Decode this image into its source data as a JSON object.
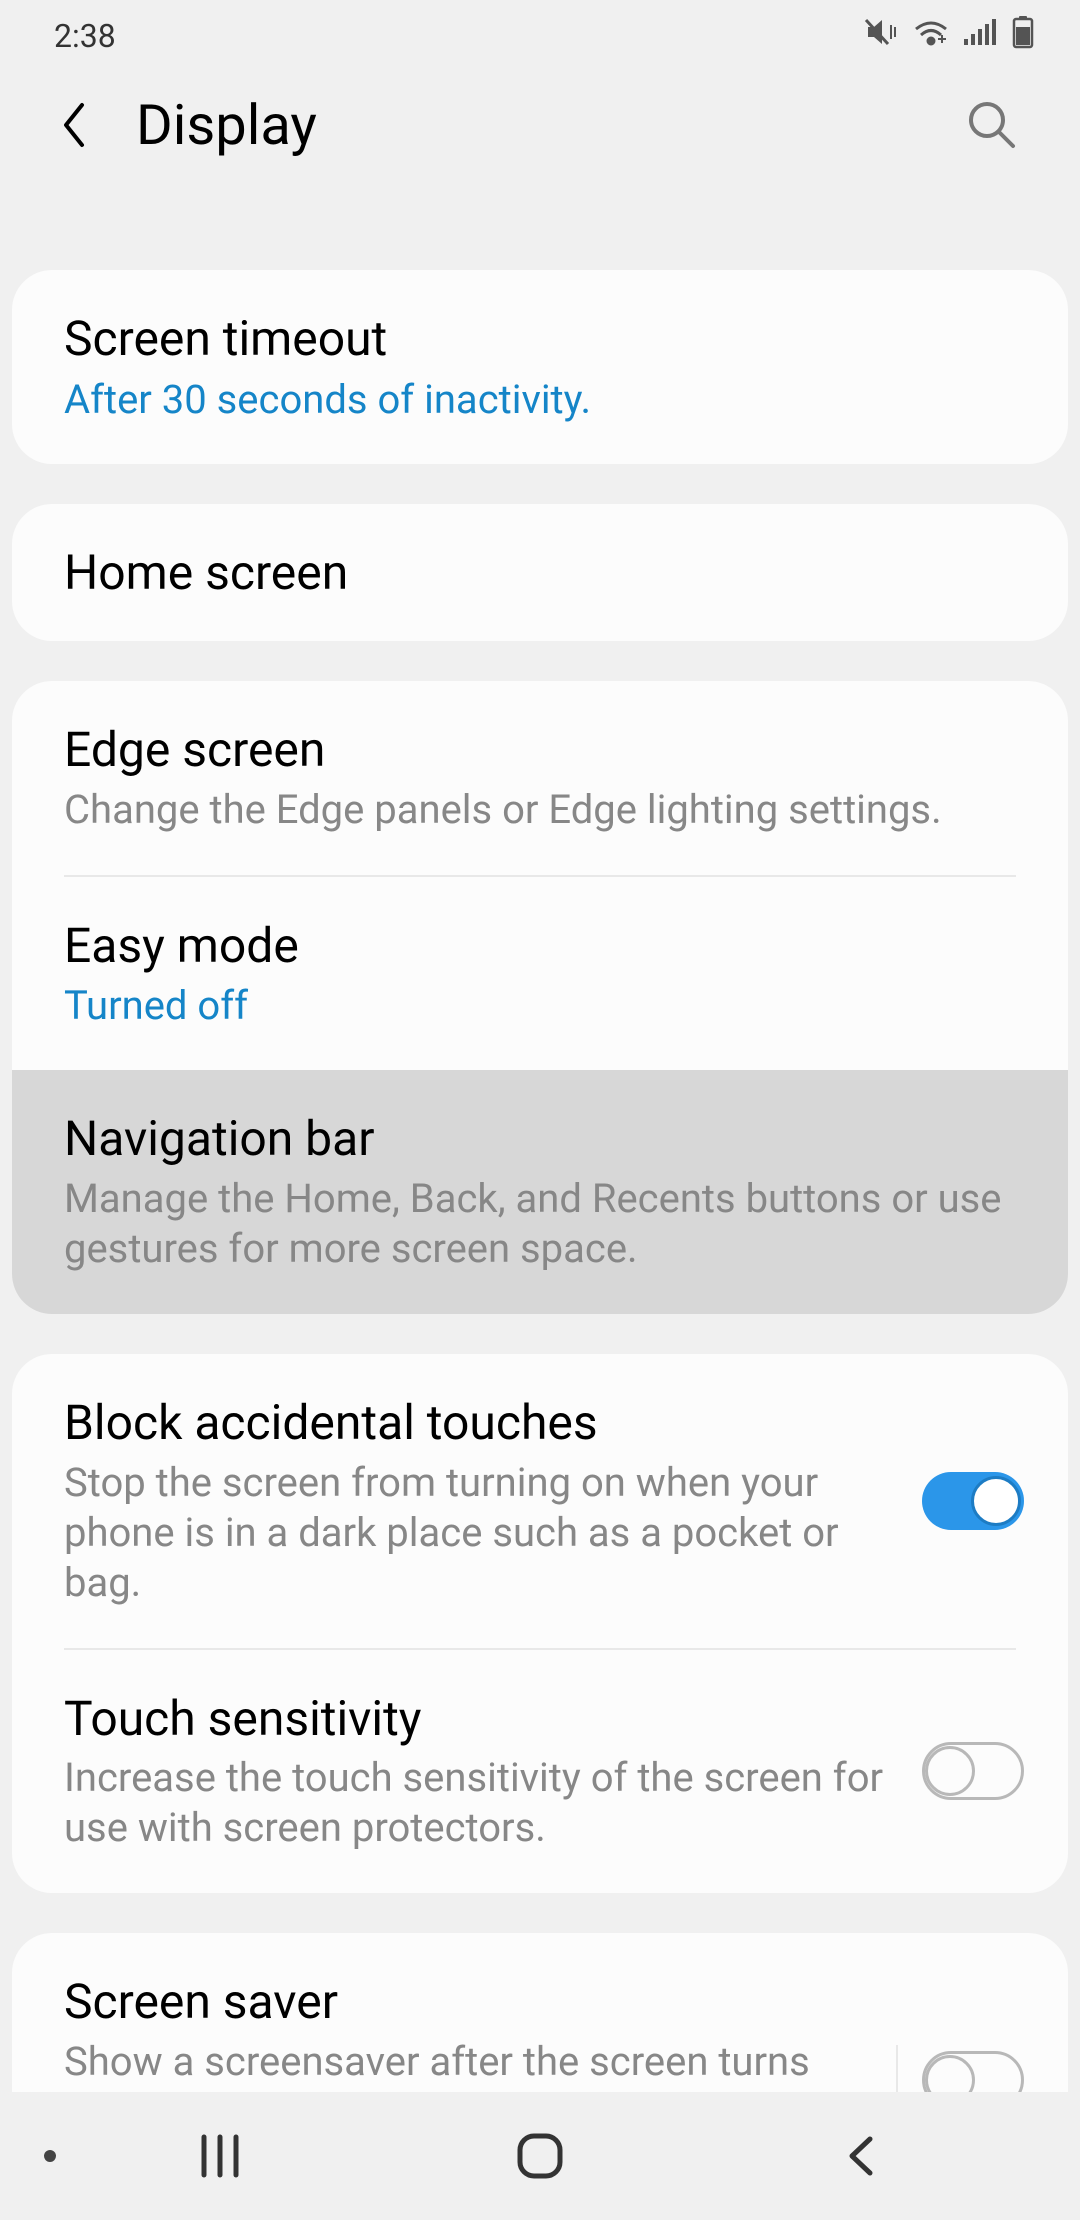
{
  "status": {
    "time": "2:38"
  },
  "header": {
    "title": "Display"
  },
  "settings": {
    "screen_timeout": {
      "title": "Screen timeout",
      "subtitle": "After 30 seconds of inactivity."
    },
    "home_screen": {
      "title": "Home screen"
    },
    "edge_screen": {
      "title": "Edge screen",
      "subtitle": "Change the Edge panels or Edge lighting settings."
    },
    "easy_mode": {
      "title": "Easy mode",
      "subtitle": "Turned off"
    },
    "navigation_bar": {
      "title": "Navigation bar",
      "subtitle": "Manage the Home, Back, and Recents buttons or use gestures for more screen space."
    },
    "block_touches": {
      "title": "Block accidental touches",
      "subtitle": "Stop the screen from turning on when your phone is in a dark place such as a pocket or bag.",
      "enabled": true
    },
    "touch_sensitivity": {
      "title": "Touch sensitivity",
      "subtitle": "Increase the touch sensitivity of the screen for use with screen protectors.",
      "enabled": false
    },
    "screen_saver": {
      "title": "Screen saver",
      "subtitle": "Show a screensaver after the screen turns off automatically while your phone is charging.",
      "enabled": false
    }
  }
}
